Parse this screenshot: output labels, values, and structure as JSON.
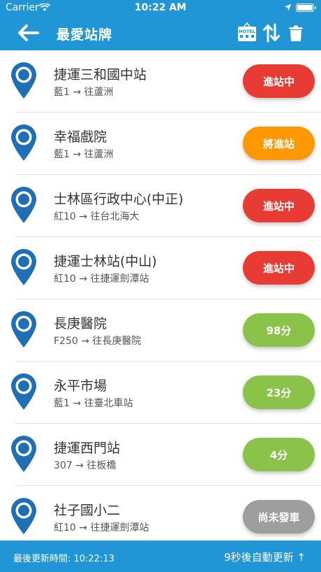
{
  "status_bar": {
    "carrier": "Carrier",
    "time": "10:22 AM"
  },
  "header": {
    "title": "最愛站牌",
    "hotel_label": "HOTEL"
  },
  "colors": {
    "primary": "#2196d6",
    "arriving": "#e83b33",
    "soon": "#ff9800",
    "minutes": "#8bc34a",
    "not_departed": "#9e9e9e"
  },
  "stops": [
    {
      "name": "捷運三和國中站",
      "route": "藍1 → 往蘆洲",
      "status": "進站中",
      "status_color": "#e83b33"
    },
    {
      "name": "幸福戲院",
      "route": "藍1 → 往蘆洲",
      "status": "將進站",
      "status_color": "#ff9800"
    },
    {
      "name": "士林區行政中心(中正)",
      "route": "紅10 → 往台北海大",
      "status": "進站中",
      "status_color": "#e83b33"
    },
    {
      "name": "捷運士林站(中山)",
      "route": "紅10 → 往捷運劍潭站",
      "status": "進站中",
      "status_color": "#e83b33"
    },
    {
      "name": "長庚醫院",
      "route": "F250 → 往長庚醫院",
      "status": "98分",
      "status_color": "#8bc34a"
    },
    {
      "name": "永平市場",
      "route": "藍1 → 往臺北車站",
      "status": "23分",
      "status_color": "#8bc34a"
    },
    {
      "name": "捷運西門站",
      "route": "307 → 往板橋",
      "status": "4分",
      "status_color": "#8bc34a"
    },
    {
      "name": "社子國小二",
      "route": "紅10 → 往捷運劍潭站",
      "status": "尚未發車",
      "status_color": "#9e9e9e"
    }
  ],
  "footer": {
    "last_update": "最後更新時間: 10:22:13",
    "auto_update": "9秒後自動更新 ↑"
  }
}
